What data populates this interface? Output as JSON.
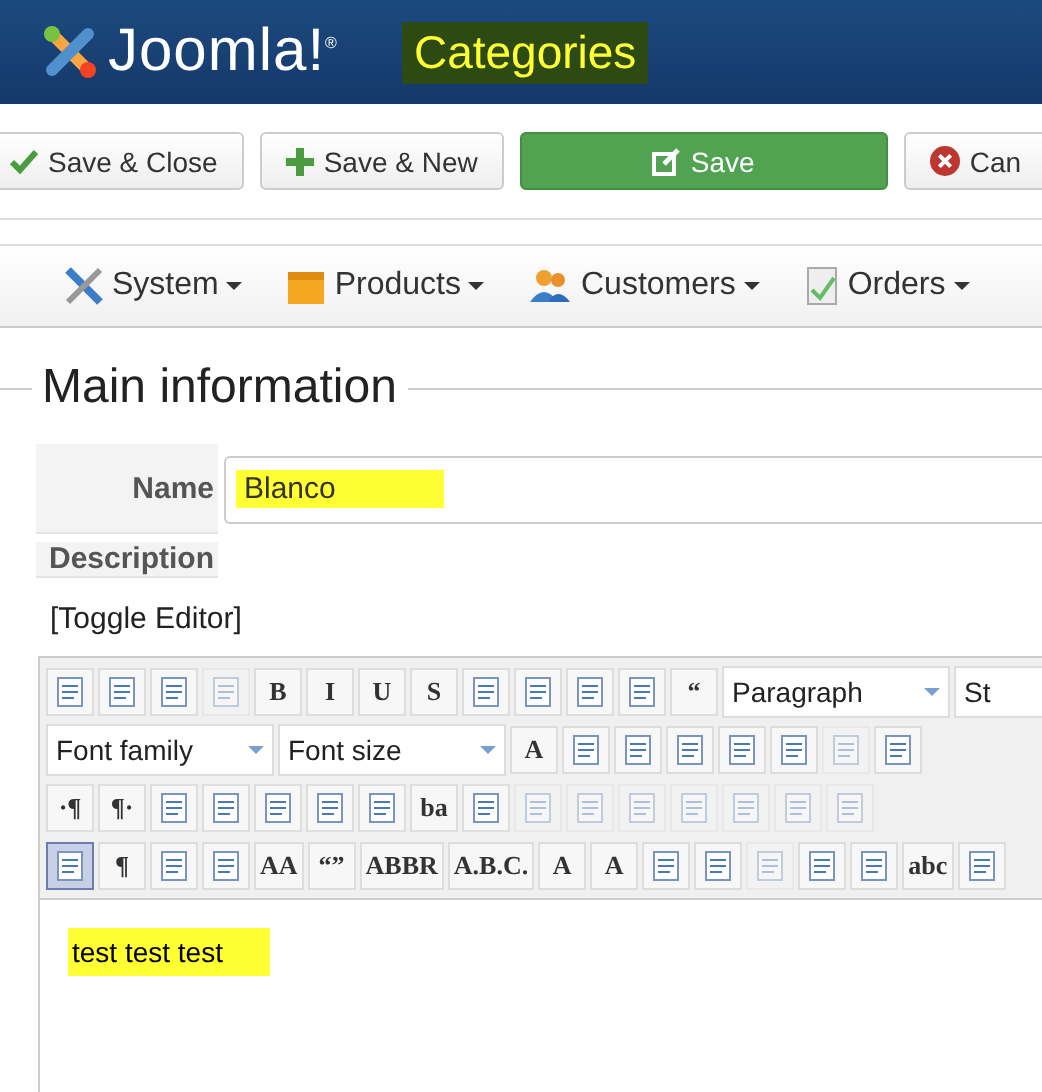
{
  "header": {
    "logo": "Joomla!",
    "logo_mark": "®",
    "title": "Categories"
  },
  "actions": [
    {
      "label": "Save & Close",
      "kind": "check"
    },
    {
      "label": "Save & New",
      "kind": "plus"
    },
    {
      "label": "Save",
      "kind": "edit"
    },
    {
      "label": "Can",
      "kind": "cancel"
    }
  ],
  "menu": [
    {
      "label": "System",
      "kind": "tools"
    },
    {
      "label": "Products",
      "kind": "box"
    },
    {
      "label": "Customers",
      "kind": "people"
    },
    {
      "label": "Orders",
      "kind": "doc"
    }
  ],
  "legend": "Main information",
  "fields": [
    {
      "label": "Name",
      "value": "Blanco"
    },
    {
      "label": "Description"
    }
  ],
  "toggle": "[Toggle Editor]",
  "toolbar": [
    [
      {
        "kind": "icon",
        "disabled": false,
        "selected": false
      },
      {
        "kind": "icon",
        "disabled": false,
        "selected": false
      },
      {
        "kind": "icon",
        "disabled": false,
        "selected": false
      },
      {
        "kind": "icon",
        "disabled": true,
        "selected": false
      },
      {
        "kind": "glyph",
        "text": "B",
        "disabled": false,
        "selected": false
      },
      {
        "kind": "glyph",
        "text": "I",
        "disabled": false,
        "selected": false
      },
      {
        "kind": "glyph",
        "text": "U",
        "disabled": false,
        "selected": false
      },
      {
        "kind": "glyph",
        "text": "S",
        "disabled": false,
        "selected": false
      },
      {
        "kind": "icon",
        "disabled": false,
        "selected": false
      },
      {
        "kind": "icon",
        "disabled": false,
        "selected": false
      },
      {
        "kind": "icon",
        "disabled": false,
        "selected": false
      },
      {
        "kind": "icon",
        "disabled": false,
        "selected": false
      },
      {
        "kind": "glyph",
        "text": "“",
        "disabled": false,
        "selected": false
      },
      {
        "kind": "select",
        "text": "Paragraph"
      },
      {
        "kind": "select",
        "text": "St"
      }
    ],
    [
      {
        "kind": "select",
        "text": "Font family"
      },
      {
        "kind": "select",
        "text": "Font size"
      },
      {
        "kind": "glyph",
        "text": "A",
        "disabled": false,
        "selected": false
      },
      {
        "kind": "icon",
        "disabled": false,
        "selected": false
      },
      {
        "kind": "icon",
        "disabled": false,
        "selected": false
      },
      {
        "kind": "icon",
        "disabled": false,
        "selected": false
      },
      {
        "kind": "icon",
        "disabled": false,
        "selected": false
      },
      {
        "kind": "icon",
        "disabled": false,
        "selected": false
      },
      {
        "kind": "icon",
        "disabled": true,
        "selected": false
      },
      {
        "kind": "icon",
        "disabled": false,
        "selected": false
      }
    ],
    [
      {
        "kind": "glyph",
        "text": "·¶",
        "disabled": false,
        "selected": false
      },
      {
        "kind": "glyph",
        "text": "¶·",
        "disabled": false,
        "selected": false
      },
      {
        "kind": "icon",
        "disabled": false,
        "selected": false
      },
      {
        "kind": "icon",
        "disabled": false,
        "selected": false
      },
      {
        "kind": "icon",
        "disabled": false,
        "selected": false
      },
      {
        "kind": "icon",
        "disabled": false,
        "selected": false
      },
      {
        "kind": "icon",
        "disabled": false,
        "selected": false
      },
      {
        "kind": "glyph",
        "text": "ba",
        "disabled": false,
        "selected": false
      },
      {
        "kind": "icon",
        "disabled": false,
        "selected": false
      },
      {
        "kind": "icon",
        "disabled": true,
        "selected": false
      },
      {
        "kind": "icon",
        "disabled": true,
        "selected": false
      },
      {
        "kind": "icon",
        "disabled": true,
        "selected": false
      },
      {
        "kind": "icon",
        "disabled": true,
        "selected": false
      },
      {
        "kind": "icon",
        "disabled": true,
        "selected": false
      },
      {
        "kind": "icon",
        "disabled": true,
        "selected": false
      },
      {
        "kind": "icon",
        "disabled": true,
        "selected": false
      }
    ],
    [
      {
        "kind": "icon",
        "disabled": false,
        "selected": true
      },
      {
        "kind": "glyph",
        "text": "¶",
        "disabled": false,
        "selected": false
      },
      {
        "kind": "icon",
        "disabled": false,
        "selected": false
      },
      {
        "kind": "icon",
        "disabled": false,
        "selected": false
      },
      {
        "kind": "glyph",
        "text": "AA",
        "disabled": false,
        "selected": false
      },
      {
        "kind": "glyph",
        "text": "“”",
        "disabled": false,
        "selected": false
      },
      {
        "kind": "glyph",
        "text": "ABBR",
        "disabled": false,
        "selected": false
      },
      {
        "kind": "glyph",
        "text": "A.B.C.",
        "disabled": false,
        "selected": false
      },
      {
        "kind": "glyph",
        "text": "A",
        "disabled": false,
        "selected": false
      },
      {
        "kind": "glyph",
        "text": "A",
        "disabled": false,
        "selected": false
      },
      {
        "kind": "icon",
        "disabled": false,
        "selected": false
      },
      {
        "kind": "icon",
        "disabled": false,
        "selected": false
      },
      {
        "kind": "icon",
        "disabled": true,
        "selected": false
      },
      {
        "kind": "icon",
        "disabled": false,
        "selected": false
      },
      {
        "kind": "icon",
        "disabled": false,
        "selected": false
      },
      {
        "kind": "glyph",
        "text": "abc",
        "disabled": false,
        "selected": false
      },
      {
        "kind": "icon",
        "disabled": false,
        "selected": false
      }
    ]
  ],
  "content": "test test test"
}
